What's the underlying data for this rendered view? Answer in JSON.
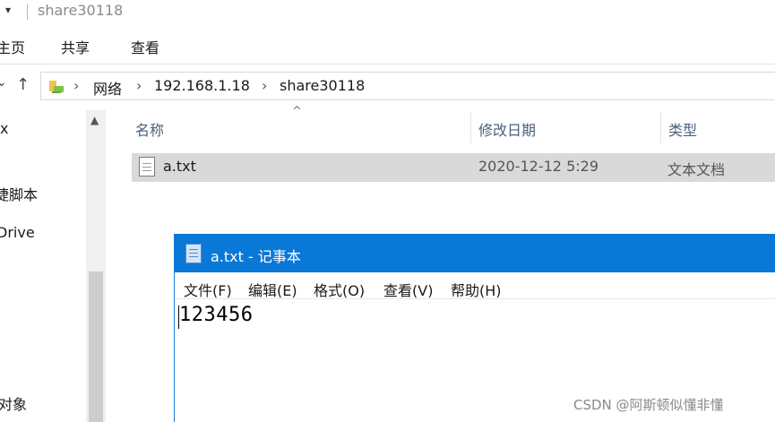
{
  "titlebar": {
    "title": "share30118"
  },
  "ribbon": {
    "tabs": [
      "主页",
      "共享",
      "查看"
    ]
  },
  "address": {
    "crumbs": [
      "网络",
      "192.168.1.18",
      "share30118"
    ]
  },
  "navpane": {
    "items": [
      "x",
      "",
      "捷脚本",
      "Drive",
      "",
      "",
      "",
      "",
      "对象"
    ]
  },
  "columns": {
    "name": "名称",
    "date": "修改日期",
    "type": "类型"
  },
  "files": [
    {
      "name": "a.txt",
      "date": "2020-12-12 5:29",
      "type": "文本文档"
    }
  ],
  "notepad": {
    "title": "a.txt - 记事本",
    "menu": [
      "文件(F)",
      "编辑(E)",
      "格式(O)",
      "查看(V)",
      "帮助(H)"
    ],
    "content": "123456"
  },
  "watermark": "CSDN @阿斯顿似懂非懂",
  "colors": {
    "accent": "#0a78d7",
    "selection": "#d9d9d9"
  }
}
